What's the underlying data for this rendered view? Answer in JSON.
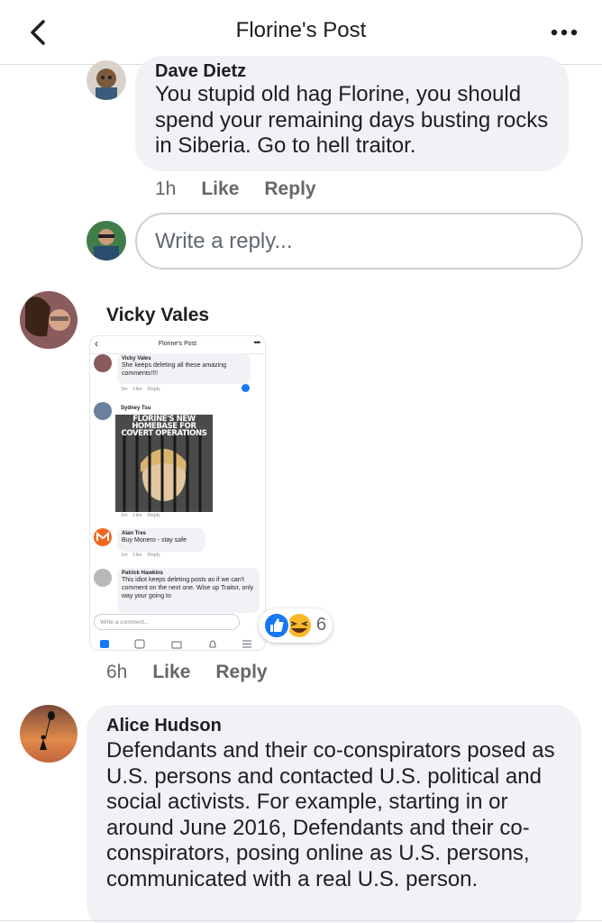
{
  "header": {
    "title": "Florine's Post"
  },
  "comments": [
    {
      "author": "Dave Dietz",
      "text": "You stupid old hag Florine, you should spend your remaining days busting rocks in Siberia.  Go to hell traitor.",
      "time": "1h",
      "like": "Like",
      "reply": "Reply"
    },
    {
      "author": "Vicky Vales",
      "time": "6h",
      "like": "Like",
      "reply": "Reply",
      "reaction_count": "6"
    },
    {
      "author": "Alice Hudson",
      "text": "Defendants and their co-conspirators posed as U.S. persons and contacted U.S. political and social activists. For example, starting in or around June 2016, Defendants and their co-conspirators, posing online as U.S. persons, communicated with a real U.S. person."
    }
  ],
  "reply_box": {
    "placeholder": "Write a reply..."
  },
  "embedded_screenshot": {
    "title": "Florine's Post",
    "comments": [
      {
        "author": "Vicky Vales",
        "text": "She keeps deleting all these amazing comments!!!!",
        "time": "3m",
        "like": "Like",
        "reply": "Reply"
      },
      {
        "author": "Sydney Tsu",
        "meme_caption": "FLORINE'S NEW HOMEBASE FOR COVERT OPERATIONS",
        "time": "2m",
        "like": "Like",
        "reply": "Reply"
      },
      {
        "author": "Alan Tres",
        "text": "Buy Monero - stay safe",
        "time": "1m",
        "like": "Like",
        "reply": "Reply"
      },
      {
        "author": "Patrick Hawkins",
        "text": "This idiot keeps deleting posts as if we can't comment on the next one. Wise up Traitor, only way your going to"
      }
    ],
    "write_placeholder": "Write a comment..."
  },
  "colors": {
    "accent": "#1877f2",
    "bubble": "#f0f2f5",
    "meta_text": "#65676b"
  },
  "icons": [
    "back-chevron-icon",
    "more-dots-icon",
    "like-reaction-icon",
    "haha-reaction-icon"
  ]
}
